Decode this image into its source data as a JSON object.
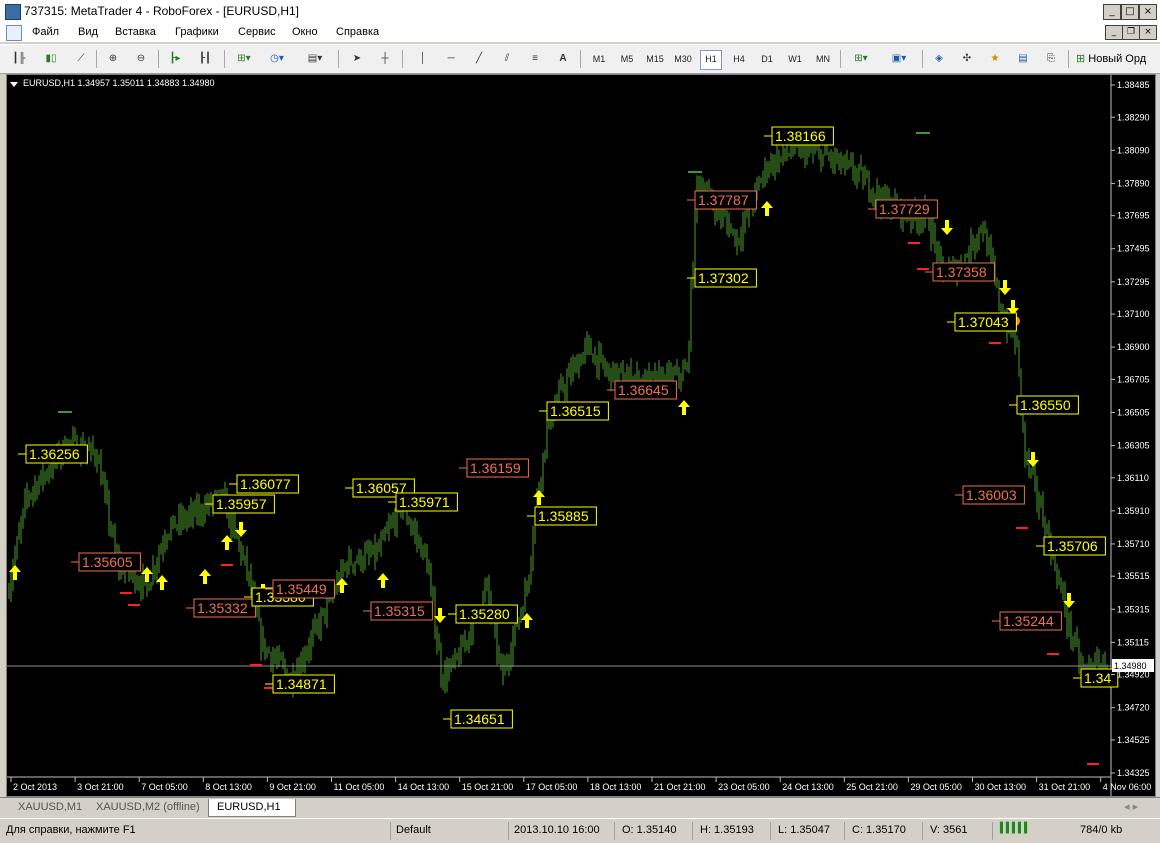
{
  "window": {
    "title": "737315: MetaTrader 4 - RoboForex - [EURUSD,H1]"
  },
  "menu": [
    "Файл",
    "Вид",
    "Вставка",
    "Графики",
    "Сервис",
    "Окно",
    "Справка"
  ],
  "toolbar": {
    "timeframes": [
      "M1",
      "M5",
      "M15",
      "M30",
      "H1",
      "H4",
      "D1",
      "W1",
      "MN"
    ],
    "active_timeframe": "H1",
    "new_order_label": "Новый Орд"
  },
  "chart": {
    "info": "EURUSD,H1  1.34957 1.35011 1.34883 1.34980",
    "current_price": "1.34980",
    "price_ticks": [
      "1.38485",
      "1.38290",
      "1.38090",
      "1.37890",
      "1.37695",
      "1.37495",
      "1.37295",
      "1.37100",
      "1.36900",
      "1.36705",
      "1.36505",
      "1.36305",
      "1.36110",
      "1.35910",
      "1.35710",
      "1.35515",
      "1.35315",
      "1.35115",
      "1.34920",
      "1.34720",
      "1.34525",
      "1.34325"
    ],
    "time_ticks": [
      "2 Oct 2013",
      "3 Oct 21:00",
      "7 Oct 05:00",
      "8 Oct 13:00",
      "9 Oct 21:00",
      "11 Oct 05:00",
      "14 Oct 13:00",
      "15 Oct 21:00",
      "17 Oct 05:00",
      "18 Oct 13:00",
      "21 Oct 21:00",
      "23 Oct 05:00",
      "24 Oct 13:00",
      "25 Oct 21:00",
      "29 Oct 05:00",
      "30 Oct 13:00",
      "31 Oct 21:00",
      "4 Nov 06:00"
    ],
    "labels": [
      {
        "text": "1.36256",
        "color": "yellow"
      },
      {
        "text": "1.36077",
        "color": "yellow"
      },
      {
        "text": "1.35957",
        "color": "yellow"
      },
      {
        "text": "1.35605",
        "color": "salmon"
      },
      {
        "text": "1.35332",
        "color": "salmon"
      },
      {
        "text": "1.35380",
        "color": "yellow"
      },
      {
        "text": "1.35449",
        "color": "salmon"
      },
      {
        "text": "1.34871",
        "color": "yellow"
      },
      {
        "text": "1.36057",
        "color": "yellow"
      },
      {
        "text": "1.35971",
        "color": "yellow"
      },
      {
        "text": "1.35315",
        "color": "salmon"
      },
      {
        "text": "1.35280",
        "color": "yellow"
      },
      {
        "text": "1.34651",
        "color": "yellow"
      },
      {
        "text": "1.36159",
        "color": "salmon"
      },
      {
        "text": "1.35885",
        "color": "yellow"
      },
      {
        "text": "1.36515",
        "color": "yellow"
      },
      {
        "text": "1.36645",
        "color": "salmon"
      },
      {
        "text": "1.37302",
        "color": "yellow"
      },
      {
        "text": "1.37787",
        "color": "salmon"
      },
      {
        "text": "1.38166",
        "color": "yellow"
      },
      {
        "text": "1.37729",
        "color": "salmon"
      },
      {
        "text": "1.37358",
        "color": "salmon"
      },
      {
        "text": "1.37043",
        "color": "yellow"
      },
      {
        "text": "1.36550",
        "color": "yellow"
      },
      {
        "text": "1.36003",
        "color": "salmon"
      },
      {
        "text": "1.35706",
        "color": "yellow"
      },
      {
        "text": "1.35244",
        "color": "salmon"
      },
      {
        "text": "1.34",
        "color": "yellow"
      }
    ]
  },
  "tabs": [
    "XAUUSD,M1",
    "XAUUSD,M2 (offline)",
    "EURUSD,H1"
  ],
  "active_tab": "EURUSD,H1",
  "status": {
    "help": "Для справки, нажмите F1",
    "profile": "Default",
    "datetime": "2013.10.10 16:00",
    "open": "O: 1.35140",
    "high": "H: 1.35193",
    "low": "L: 1.35047",
    "close": "C: 1.35170",
    "volume": "V: 3561",
    "traffic": "784/0 kb"
  },
  "colors": {
    "candle": "#4c9a2a",
    "label_yellow": "#ffff00",
    "label_salmon": "#f07050",
    "arrow": "#ffff00",
    "grid": "#c0c0c0"
  }
}
